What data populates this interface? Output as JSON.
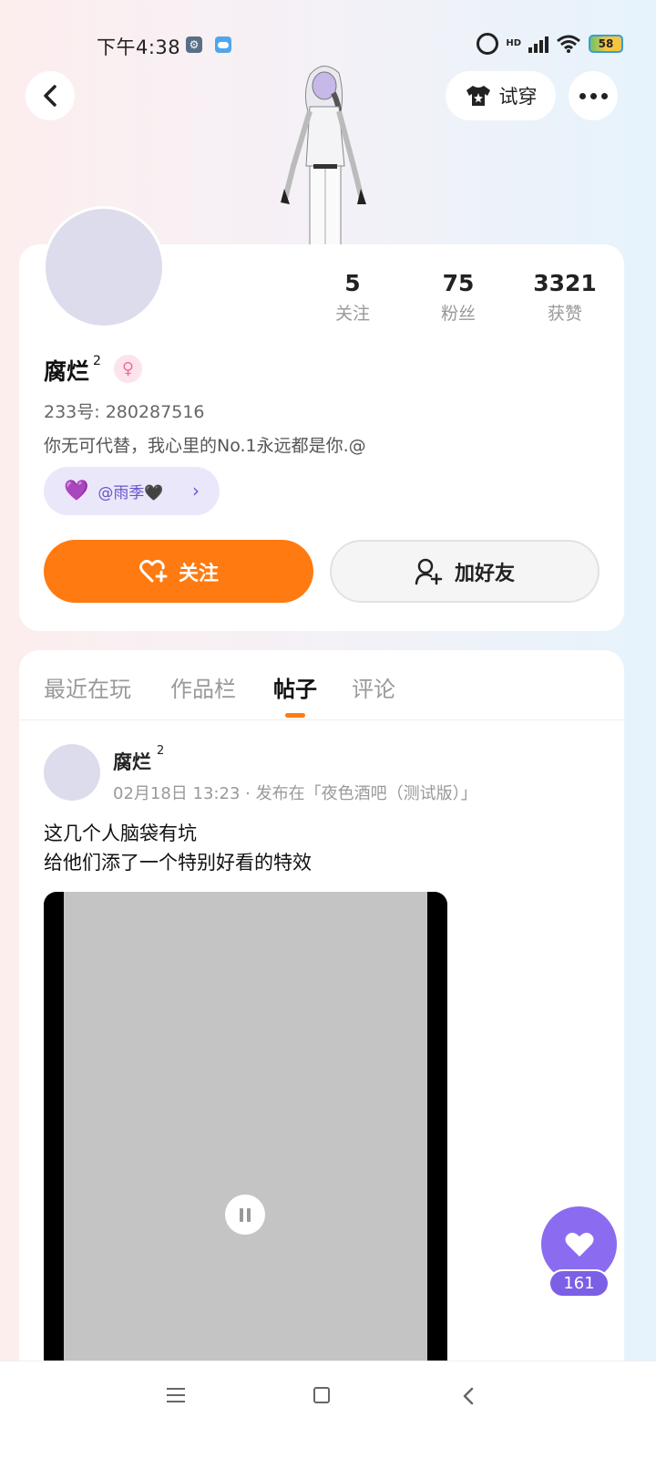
{
  "status_bar": {
    "time": "下午4:38",
    "hd": "HD",
    "battery": "58"
  },
  "header": {
    "tryon_label": "试穿"
  },
  "profile": {
    "stats": [
      {
        "value": "5",
        "label": "关注"
      },
      {
        "value": "75",
        "label": "粉丝"
      },
      {
        "value": "3321",
        "label": "获赞"
      }
    ],
    "name": "腐烂",
    "name_sup": "2",
    "gender_symbol": "♀",
    "id_line": "233号: 280287516",
    "bio": "你无可代替，我心里的No.1永远都是你.@",
    "couple_tag": "@雨季🖤",
    "follow_label": "关注",
    "add_friend_label": "加好友"
  },
  "tabs": [
    {
      "label": "最近在玩"
    },
    {
      "label": "作品栏"
    },
    {
      "label": "帖子"
    },
    {
      "label": "评论"
    }
  ],
  "post": {
    "author": "腐烂",
    "author_sup": "2",
    "meta": "02月18日 13:23 · 发布在「夜色酒吧（测试版）」",
    "text_lines": [
      "这几个人脑袋有坑",
      "给他们添了一个特别好看的特效"
    ]
  },
  "like": {
    "count": "161"
  },
  "colors": {
    "accent": "#ff7a10",
    "like_purple": "#8b6cf0"
  }
}
